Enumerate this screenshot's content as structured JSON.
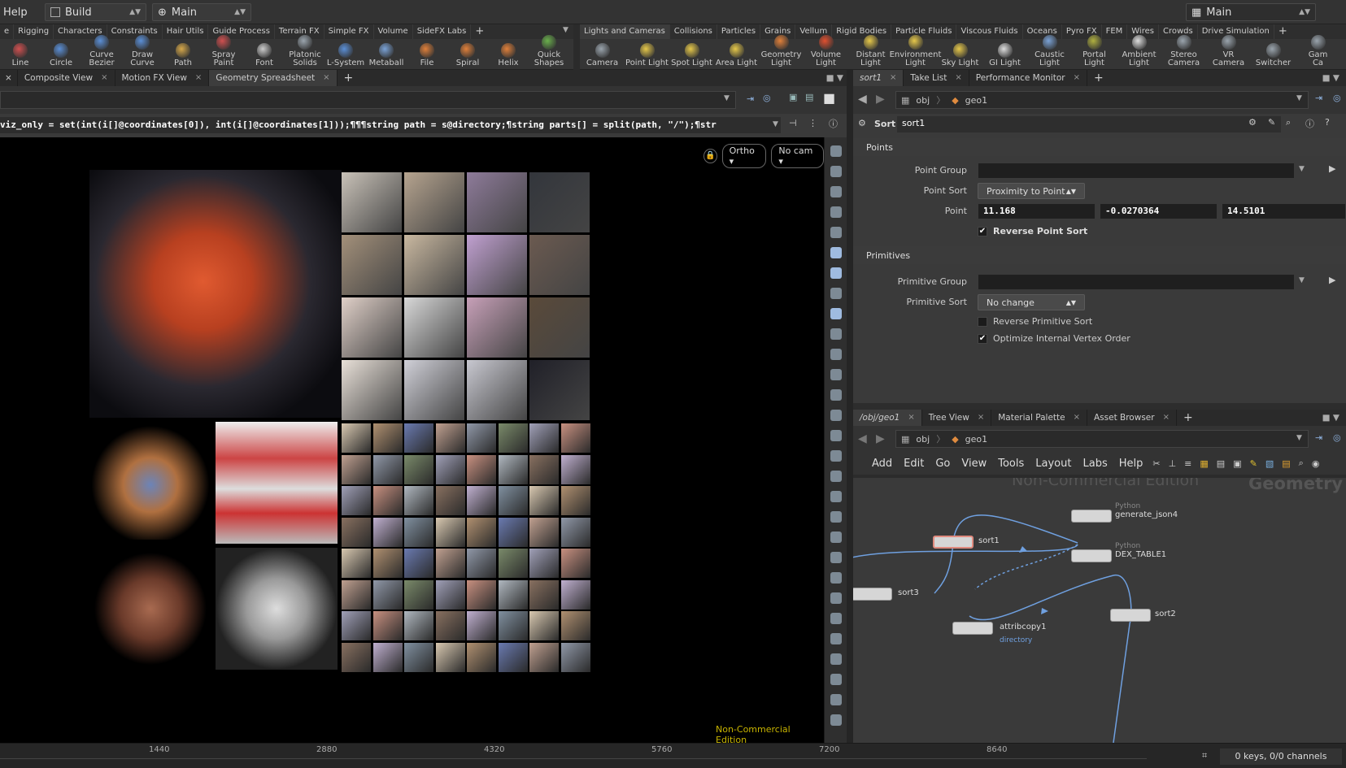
{
  "menubar": {
    "help_label": "Help",
    "desktop_dropdown": "Build",
    "context_dropdown": "Main",
    "right_desktop_dropdown": "Main"
  },
  "shelf_left": {
    "tabs": [
      "e",
      "Rigging",
      "Characters",
      "Constraints",
      "Hair Utils",
      "Guide Process",
      "Terrain FX",
      "Simple FX",
      "Volume",
      "SideFX Labs"
    ],
    "tools": [
      {
        "label": "Line",
        "icon": "line-icon",
        "color": "#d05050"
      },
      {
        "label": "Circle",
        "icon": "circle-icon",
        "color": "#5b8fd6"
      },
      {
        "label": "Curve Bezier",
        "icon": "curve-bezier-icon",
        "color": "#5b8fd6"
      },
      {
        "label": "Draw Curve",
        "icon": "draw-curve-icon",
        "color": "#5b8fd6"
      },
      {
        "label": "Path",
        "icon": "path-icon",
        "color": "#d6a84a"
      },
      {
        "label": "Spray Paint",
        "icon": "spray-paint-icon",
        "color": "#d05050"
      },
      {
        "label": "Font",
        "icon": "font-icon",
        "color": "#cccccc"
      },
      {
        "label": "Platonic\nSolids",
        "icon": "platonic-solids-icon",
        "color": "#9aa4ad"
      },
      {
        "label": "L-System",
        "icon": "l-system-icon",
        "color": "#5b8fd6"
      },
      {
        "label": "Metaball",
        "icon": "metaball-icon",
        "color": "#7aa2d6"
      },
      {
        "label": "File",
        "icon": "file-icon",
        "color": "#e0803a"
      },
      {
        "label": "Spiral",
        "icon": "spiral-icon",
        "color": "#e0803a"
      },
      {
        "label": "Helix",
        "icon": "helix-icon",
        "color": "#e0803a"
      },
      {
        "label": "Quick Shapes",
        "icon": "quick-shapes-icon",
        "color": "#6ab04c"
      }
    ]
  },
  "shelf_right": {
    "tabs": [
      "Lights and Cameras",
      "Collisions",
      "Particles",
      "Grains",
      "Vellum",
      "Rigid Bodies",
      "Particle Fluids",
      "Viscous Fluids",
      "Oceans",
      "Pyro FX",
      "FEM",
      "Wires",
      "Crowds",
      "Drive Simulation"
    ],
    "tools": [
      {
        "label": "Camera",
        "icon": "camera-icon",
        "color": "#9aa4ad"
      },
      {
        "label": "Point Light",
        "icon": "point-light-icon",
        "color": "#e6c84a"
      },
      {
        "label": "Spot Light",
        "icon": "spot-light-icon",
        "color": "#e6c84a"
      },
      {
        "label": "Area Light",
        "icon": "area-light-icon",
        "color": "#e6c84a"
      },
      {
        "label": "Geometry\nLight",
        "icon": "geometry-light-icon",
        "color": "#e0803a"
      },
      {
        "label": "Volume Light",
        "icon": "volume-light-icon",
        "color": "#e05030"
      },
      {
        "label": "Distant Light",
        "icon": "distant-light-icon",
        "color": "#e6c84a"
      },
      {
        "label": "Environment\nLight",
        "icon": "environment-light-icon",
        "color": "#e6c84a"
      },
      {
        "label": "Sky Light",
        "icon": "sky-light-icon",
        "color": "#e6c84a"
      },
      {
        "label": "GI Light",
        "icon": "gi-light-icon",
        "color": "#dddddd"
      },
      {
        "label": "Caustic Light",
        "icon": "caustic-light-icon",
        "color": "#7aa2d6"
      },
      {
        "label": "Portal Light",
        "icon": "portal-light-icon",
        "color": "#b0b040"
      },
      {
        "label": "Ambient Light",
        "icon": "ambient-light-icon",
        "color": "#dddddd"
      },
      {
        "label": "Stereo\nCamera",
        "icon": "stereo-camera-icon",
        "color": "#9aa4ad"
      },
      {
        "label": "VR Camera",
        "icon": "vr-camera-icon",
        "color": "#9aa4ad"
      },
      {
        "label": "Switcher",
        "icon": "switcher-icon",
        "color": "#9aa4ad"
      },
      {
        "label": "Gam\nCa",
        "icon": "gamepad-camera-icon",
        "color": "#9aa4ad"
      }
    ]
  },
  "left_pane": {
    "tabs": [
      "Composite View",
      "Motion FX View",
      "Geometry Spreadsheet"
    ],
    "code_line": "viz_only = set(int(i[]@coordinates[0]), int(i[]@coordinates[1]));¶¶¶string path = s@directory;¶string parts[] = split(path, \"/\");¶str",
    "view_mode": "Ortho",
    "camera": "No cam",
    "watermark": "Non-Commercial Edition"
  },
  "param_pane": {
    "tabs": [
      "sort1",
      "Take List",
      "Performance Monitor"
    ],
    "path": [
      "obj",
      "geo1"
    ],
    "node_type": "Sort",
    "node_name": "sort1",
    "sections": {
      "points": "Points",
      "primitives": "Primitives"
    },
    "point_group_label": "Point Group",
    "point_group_value": "",
    "point_sort_label": "Point Sort",
    "point_sort_value": "Proximity to Point",
    "point_label": "Point",
    "point_values": [
      "11.168",
      "-0.0270364",
      "14.5101"
    ],
    "reverse_point_sort_label": "Reverse Point Sort",
    "reverse_point_sort": true,
    "primitive_group_label": "Primitive Group",
    "primitive_group_value": "",
    "primitive_sort_label": "Primitive Sort",
    "primitive_sort_value": "No change",
    "reverse_primitive_sort_label": "Reverse Primitive Sort",
    "reverse_primitive_sort": false,
    "optimize_label": "Optimize Internal Vertex Order",
    "optimize": true
  },
  "network_pane": {
    "tabs": [
      "/obj/geo1",
      "Tree View",
      "Material Palette",
      "Asset Browser"
    ],
    "path": [
      "obj",
      "geo1"
    ],
    "menus": [
      "Add",
      "Edit",
      "Go",
      "View",
      "Tools",
      "Layout",
      "Labs",
      "Help"
    ],
    "watermark": "Non-Commercial Edition",
    "context_label": "Geometry",
    "nodes": [
      {
        "name": "generate_json4",
        "type": "Python"
      },
      {
        "name": "sort1",
        "type": ""
      },
      {
        "name": "DEX_TABLE1",
        "type": "Python"
      },
      {
        "name": "sort3",
        "type": ""
      },
      {
        "name": "attribcopy1",
        "type": "",
        "sub": "directory"
      },
      {
        "name": "sort2",
        "type": ""
      }
    ]
  },
  "timeline": {
    "ticks": [
      "1440",
      "2880",
      "4320",
      "5760",
      "7200",
      "8640"
    ],
    "status": "0 keys, 0/0 channels"
  },
  "colors": {
    "accent_blue": "#6fa0e0",
    "watermark_yellow": "#c8b400",
    "selected_node": "#e08b7f"
  }
}
